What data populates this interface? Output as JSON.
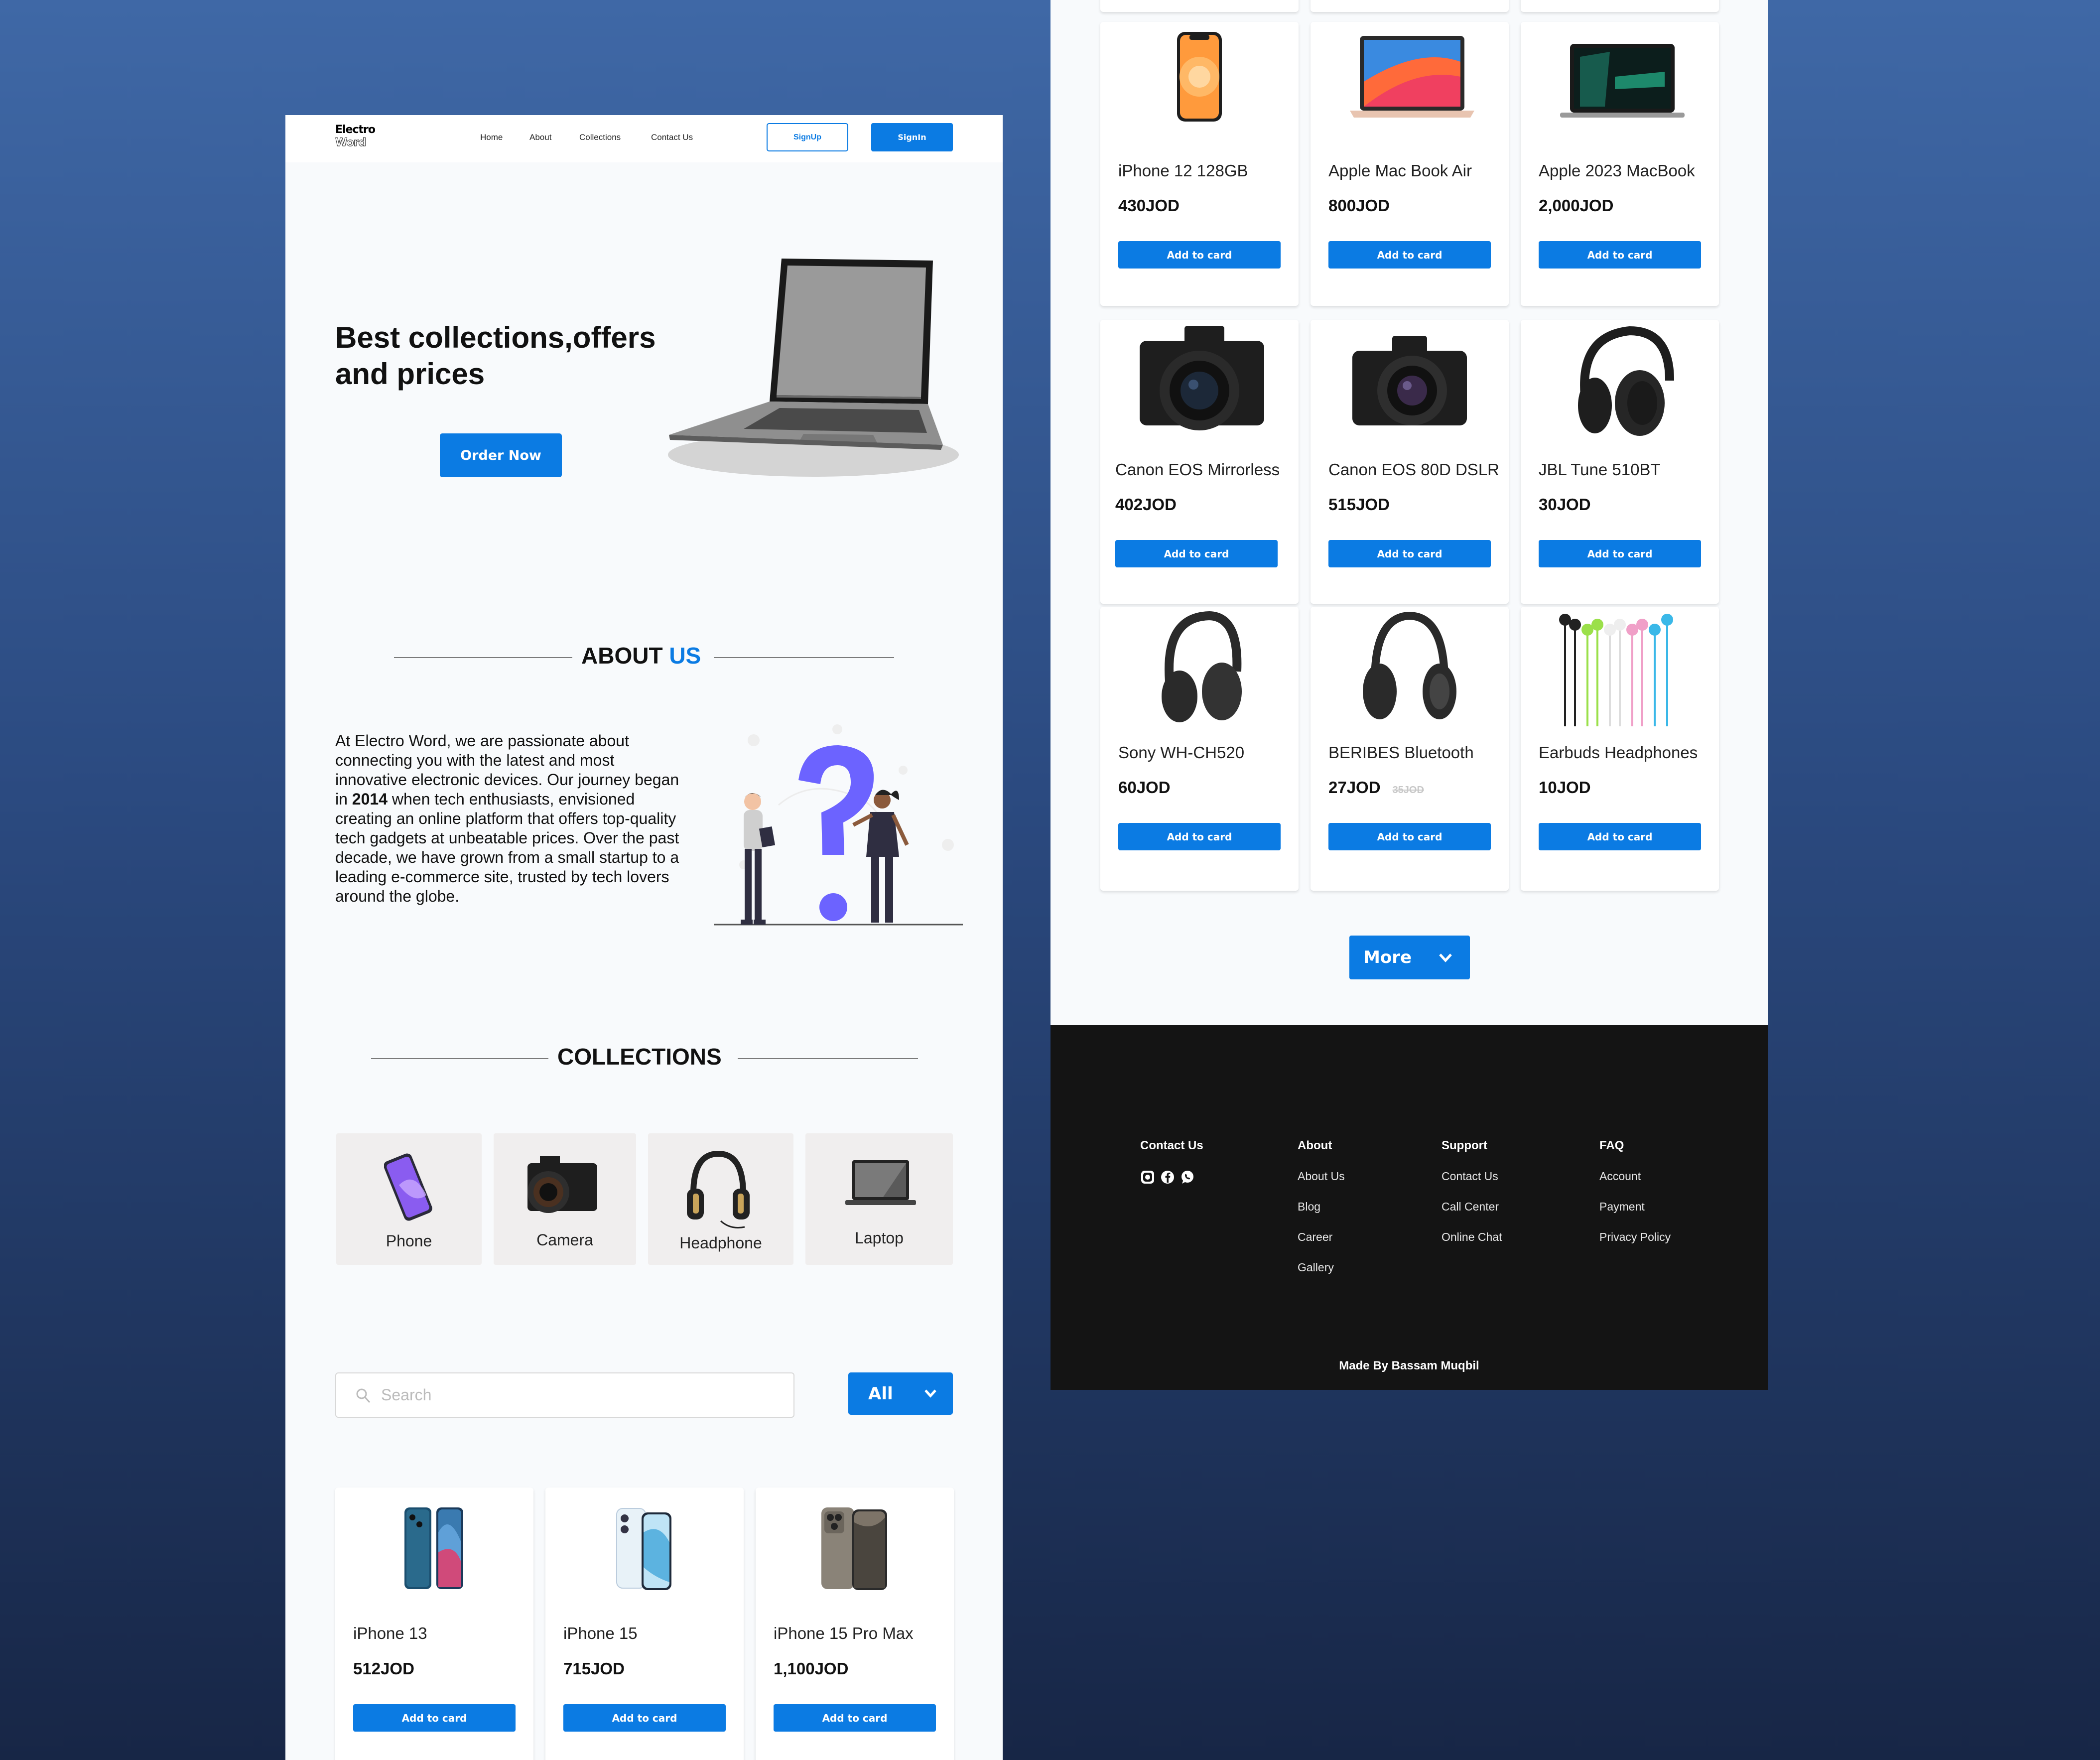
{
  "brand": {
    "line1": "Electro",
    "line2": "Word"
  },
  "nav": {
    "links": [
      "Home",
      "About",
      "Collections",
      "Contact Us"
    ],
    "signup": "SignUp",
    "signin": "SignIn"
  },
  "hero": {
    "title_line1": "Best collections,offers",
    "title_line2": "and prices",
    "cta": "Order Now"
  },
  "about": {
    "heading_main": "ABOUT ",
    "heading_accent": "US",
    "text_before": "At Electro Word, we are passionate about connecting you with the latest and most innovative electronic devices. Our journey began in ",
    "year": "2014",
    "text_after": " when tech enthusiasts, envisioned creating an online platform that offers top-quality tech gadgets at unbeatable prices. Over the past decade, we have grown from a small startup to a leading e-commerce site, trusted by tech lovers around the globe."
  },
  "collections": {
    "heading": "COLLECTIONS",
    "categories": [
      "Phone",
      "Camera",
      "Headphone",
      "Laptop"
    ]
  },
  "search": {
    "placeholder": "Search",
    "filter_value": "All"
  },
  "add_label": "Add to card",
  "products": [
    {
      "name": "iPhone 13",
      "price": "512JOD"
    },
    {
      "name": "iPhone 15",
      "price": "715JOD"
    },
    {
      "name": "iPhone 15 Pro Max",
      "price": "1,100JOD"
    },
    {
      "name": "iPhone 12 128GB",
      "price": "430JOD"
    },
    {
      "name": "Apple Mac Book Air",
      "price": "800JOD"
    },
    {
      "name": "Apple 2023 MacBook",
      "price": "2,000JOD"
    },
    {
      "name": "Canon EOS Mirrorless",
      "price": "402JOD"
    },
    {
      "name": "Canon EOS 80D DSLR",
      "price": "515JOD"
    },
    {
      "name": "JBL Tune 510BT",
      "price": "30JOD"
    },
    {
      "name": "Sony WH-CH520",
      "price": "60JOD"
    },
    {
      "name": "BERIBES Bluetooth",
      "price": "27JOD",
      "old_price": "35JOD"
    },
    {
      "name": "Earbuds Headphones",
      "price": "10JOD"
    }
  ],
  "more_label": "More",
  "footer": {
    "contact_heading": "Contact Us",
    "social_icons": [
      "instagram-icon",
      "facebook-icon",
      "whatsapp-icon"
    ],
    "columns": [
      {
        "heading": "About",
        "links": [
          "About Us",
          "Blog",
          "Career",
          "Gallery"
        ]
      },
      {
        "heading": "Support",
        "links": [
          "Contact Us",
          "Call Center",
          "Online Chat"
        ]
      },
      {
        "heading": "FAQ",
        "links": [
          "Account",
          "Payment",
          "Privacy Policy"
        ]
      }
    ],
    "credit": "Made By Bassam Muqbil"
  },
  "colors": {
    "accent": "#0b7be3",
    "footer_bg": "#141414",
    "page_bg": "#f8fafc"
  }
}
